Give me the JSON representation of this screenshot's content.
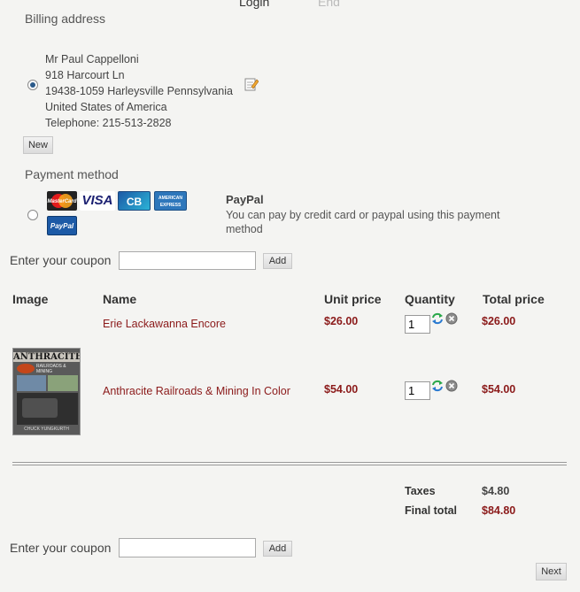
{
  "steps": [
    "Login",
    "End"
  ],
  "billing": {
    "title": "Billing address",
    "lines": [
      "Mr Paul Cappelloni",
      "918 Harcourt Ln",
      "19438-1059 Harleysville Pennsylvania",
      "United States of America",
      "Telephone: 215-513-2828"
    ],
    "new_button": "New"
  },
  "payment": {
    "title": "Payment method",
    "name": "PayPal",
    "description": "You can pay by credit card or paypal using this payment method",
    "cards": {
      "mastercard": "MasterCard",
      "visa": "VISA",
      "cb": "CB",
      "amex": "AMERICAN EXPRESS",
      "paypal": "PayPal"
    }
  },
  "coupon": {
    "label": "Enter your coupon",
    "value": "",
    "add_button": "Add"
  },
  "cart": {
    "headers": {
      "image": "Image",
      "name": "Name",
      "unit_price": "Unit price",
      "quantity": "Quantity",
      "total_price": "Total price"
    },
    "items": [
      {
        "name": "Erie Lackawanna Encore",
        "unit_price": "$26.00",
        "quantity": "1",
        "total": "$26.00"
      },
      {
        "name": "Anthracite Railroads & Mining In Color",
        "unit_price": "$54.00",
        "quantity": "1",
        "total": "$54.00",
        "cover": {
          "title": "ANTHRACITE",
          "subtitle": "RAILROADS & MINING",
          "author": "CHUCK YUNGKURTH"
        }
      }
    ]
  },
  "totals": {
    "taxes_label": "Taxes",
    "taxes_value": "$4.80",
    "final_label": "Final total",
    "final_value": "$84.80"
  },
  "next_button": "Next",
  "colors": {
    "price": "#8b1a1a",
    "background": "#f4f4f2"
  }
}
